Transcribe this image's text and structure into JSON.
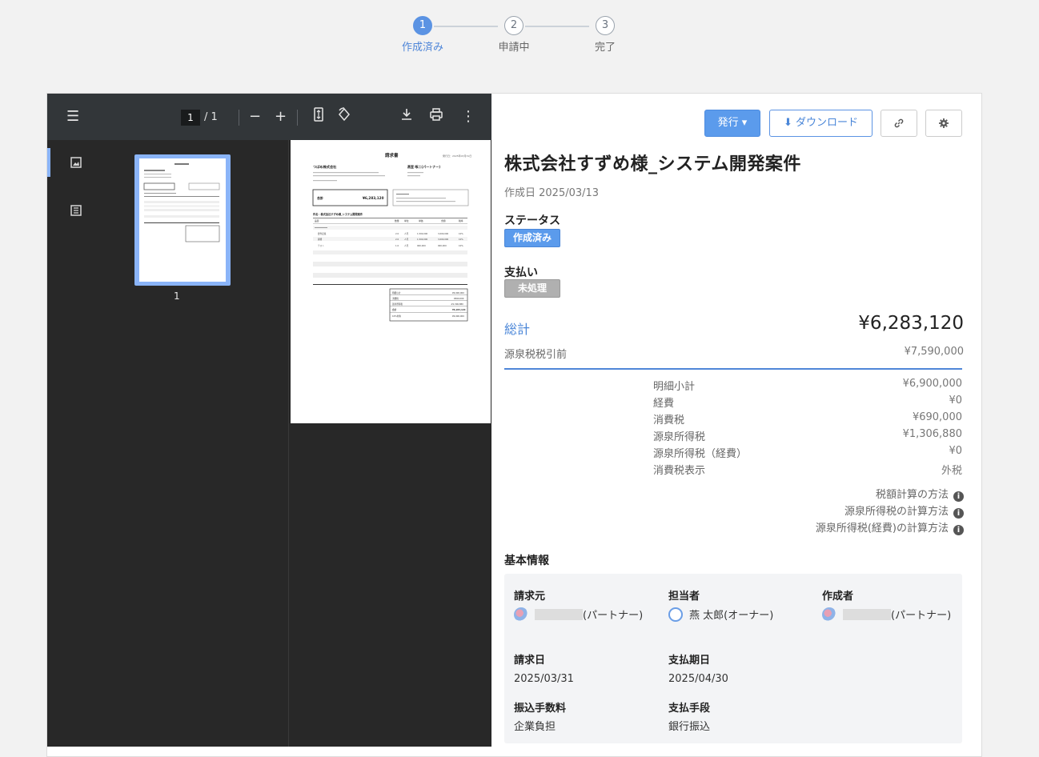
{
  "stepper": {
    "steps": [
      {
        "num": "1",
        "label": "作成済み"
      },
      {
        "num": "2",
        "label": "申請中"
      },
      {
        "num": "3",
        "label": "完了"
      }
    ]
  },
  "viewer": {
    "page_current": "1",
    "page_total": "/ 1",
    "thumb_num": "1"
  },
  "actions": {
    "issue_label": "発行 ▾",
    "download_label": "ダウンロード"
  },
  "invoice": {
    "title": "株式会社すずめ様_システム開発案件",
    "created": "作成日 2025/03/13",
    "status_heading": "ステータス",
    "status_badge": "作成済み",
    "payment_heading": "支払い",
    "payment_badge": "未処理",
    "total_label": "総計",
    "total_value": "¥6,283,120",
    "pre_label": "源泉税税引前",
    "pre_value": "¥7,590,000",
    "breakdown": [
      {
        "label": "明細小計",
        "value": "¥6,900,000"
      },
      {
        "label": "経費",
        "value": "¥0"
      },
      {
        "label": "消費税",
        "value": "¥690,000"
      },
      {
        "label": "源泉所得税",
        "value": "¥1,306,880"
      },
      {
        "label": "源泉所得税（経費）",
        "value": "¥0"
      },
      {
        "label": "消費税表示",
        "value": "外税"
      }
    ],
    "helpers": [
      "税額計算の方法",
      "源泉所得税の計算方法",
      "源泉所得税(経費)の計算方法"
    ]
  },
  "basic": {
    "heading": "基本情報",
    "billing_from_label": "請求元",
    "billing_from_value": "(パートナー)",
    "assignee_label": "担当者",
    "assignee_value": "燕 太郎(オーナー)",
    "creator_label": "作成者",
    "creator_value": "(パートナー)",
    "bill_date_label": "請求日",
    "bill_date_value": "2025/03/31",
    "due_date_label": "支払期日",
    "due_date_value": "2025/04/30",
    "fee_label": "振込手数料",
    "fee_value": "企業負担",
    "method_label": "支払手段",
    "method_value": "銀行振込"
  },
  "pdf": {
    "doc_title": "請求書",
    "issue_date": "発行日：2025年03月31日",
    "company": "つばめ株式会社",
    "partner": "燕室 啄二(パートナー)",
    "total_label": "合計",
    "total_value": "¥6,283,120",
    "subject": "件名：株式会社すずめ様_システム開発案件",
    "table_headers": [
      "品目",
      "数量",
      "単位",
      "単価",
      "金額",
      "税率"
    ],
    "rows": [
      [
        "要件定義",
        "2.0",
        "人月",
        "1,500,000",
        "3,000,000",
        "10%"
      ],
      [
        "開発",
        "2.0",
        "人月",
        "1,500,000",
        "3,000,000",
        "10%"
      ],
      [
        "テスト",
        "1.0",
        "人月",
        "900,000",
        "900,000",
        "10%"
      ]
    ],
    "summary": [
      {
        "label": "明細小計",
        "value": "¥6,900,000"
      },
      {
        "label": "消費税",
        "value": "¥690,000"
      },
      {
        "label": "源泉所得税",
        "value": "-¥1,306,880"
      },
      {
        "label": "合計",
        "value": "¥6,283,120"
      },
      {
        "label": "10%対象",
        "value": "¥6,900,000"
      }
    ]
  }
}
